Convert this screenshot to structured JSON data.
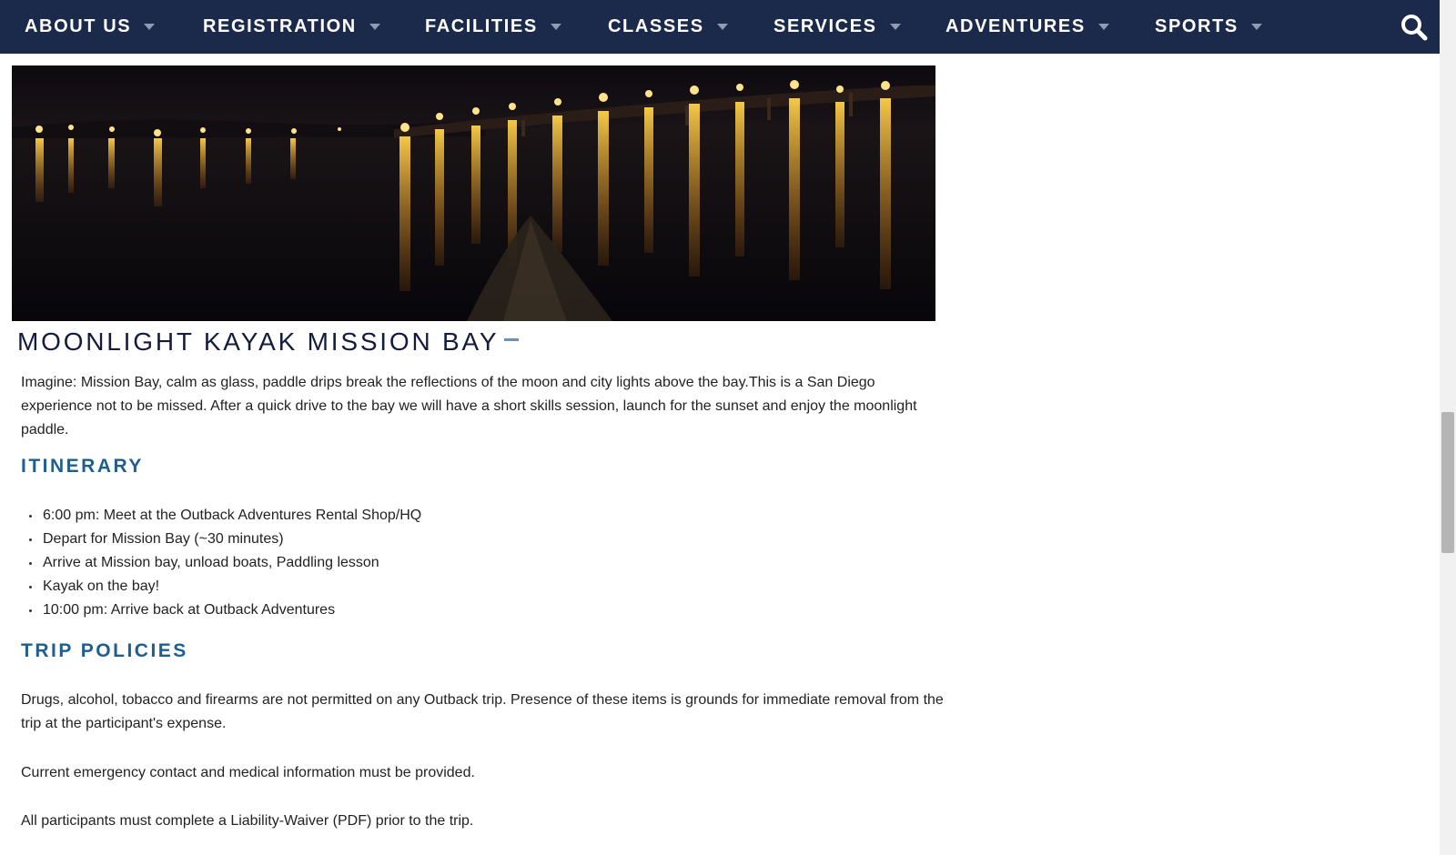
{
  "nav": {
    "items": [
      {
        "label": "ABOUT US"
      },
      {
        "label": "REGISTRATION"
      },
      {
        "label": "FACILITIES"
      },
      {
        "label": "CLASSES"
      },
      {
        "label": "SERVICES"
      },
      {
        "label": "ADVENTURES"
      },
      {
        "label": "SPORTS"
      }
    ],
    "search_icon": "search-icon",
    "background_color": "#1b2a4a"
  },
  "hero": {
    "image_subject": "night view of Mission Bay with bridge lights reflected on water from a kayak"
  },
  "trip": {
    "title": "MOONLIGHT KAYAK MISSION BAY",
    "description": "Imagine: Mission Bay, calm as glass, paddle drips break the reflections of the moon and city lights above the bay.This is a San Diego experience not to be missed. After a quick drive to the bay we will have a short skills session, launch for the sunset and enjoy the moonlight paddle.",
    "itinerary_heading": "ITINERARY",
    "itinerary": [
      "6:00 pm: Meet at the Outback Adventures Rental Shop/HQ",
      "Depart for Mission Bay (~30 minutes)",
      "Arrive at Mission bay, unload boats, Paddling lesson",
      "Kayak on the bay!",
      "10:00 pm: Arrive back at Outback Adventures"
    ],
    "policies_heading": "TRIP POLICIES",
    "policies": [
      "Drugs, alcohol, tobacco and firearms are not permitted on any Outback trip. Presence of these items is grounds for immediate removal from the trip at the participant's expense.",
      "Current emergency contact and medical information must be provided."
    ],
    "waiver": {
      "prefix": "All participants must complete a ",
      "link_text": "Liability-Waiver (PDF)",
      "suffix": " prior to the trip."
    }
  },
  "colors": {
    "heading_accent": "#1f5f8f",
    "title": "#141c3d"
  }
}
